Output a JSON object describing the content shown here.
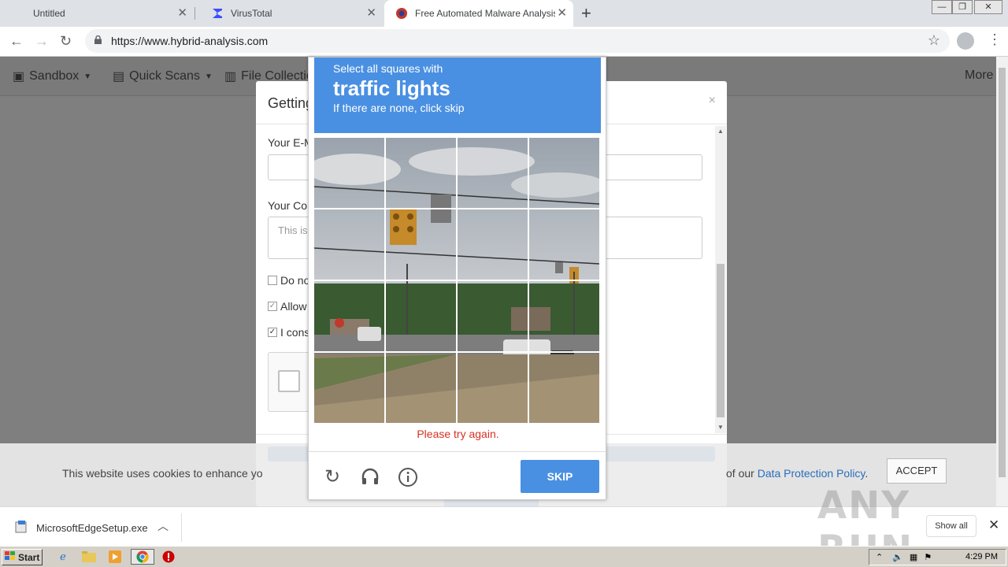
{
  "browser": {
    "tabs": [
      {
        "title": "Untitled",
        "active": false
      },
      {
        "title": "VirusTotal",
        "active": false
      },
      {
        "title": "Free Automated Malware Analysis Se",
        "active": true
      }
    ],
    "url": "https://www.hybrid-analysis.com"
  },
  "site_nav": {
    "items": [
      "Sandbox",
      "Quick Scans",
      "File Collection"
    ],
    "more": "More"
  },
  "modal": {
    "title": "Getting",
    "email_label": "Your E-M",
    "comment_label": "Your Con",
    "comment_placeholder": "This is",
    "checkboxes": [
      {
        "label": "Do no",
        "checked": false
      },
      {
        "label": "Allow",
        "checked": true
      },
      {
        "label": "I cons",
        "checked": true
      }
    ]
  },
  "cookie": {
    "text": "This website uses cookies to enhance yo",
    "text_end": "of our",
    "link": "Data Protection Policy",
    "end_punct": ".",
    "accept": "ACCEPT"
  },
  "captcha": {
    "line1": "Select all squares with",
    "line2": "traffic lights",
    "line3": "If there are none, click skip",
    "error": "Please try again.",
    "skip": "SKIP",
    "icons": [
      "reload-icon",
      "audio-icon",
      "info-icon"
    ]
  },
  "download_bar": {
    "file": "MicrosoftEdgeSetup.exe",
    "show_all": "Show all"
  },
  "watermark": "ANY RUN",
  "taskbar": {
    "start": "Start",
    "time": "4:29 PM"
  }
}
